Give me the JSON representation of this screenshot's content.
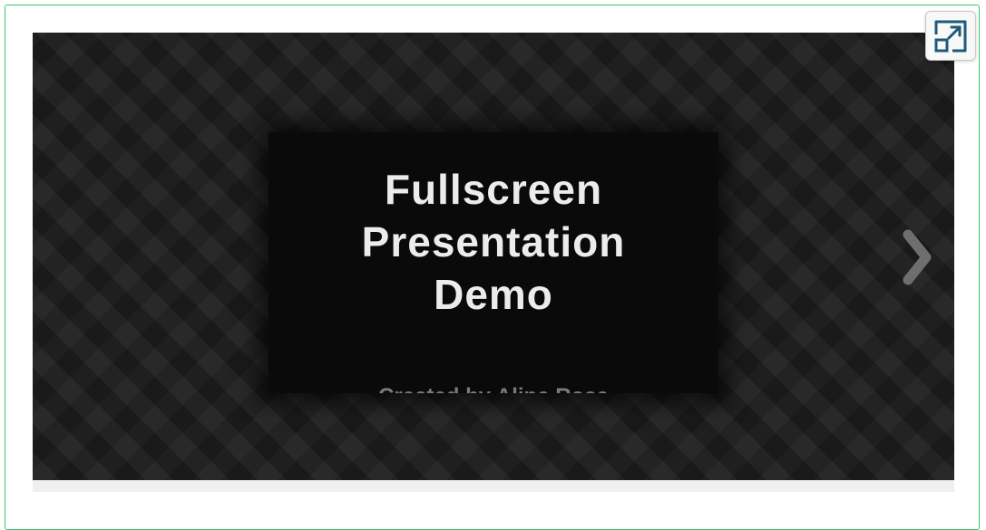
{
  "slide": {
    "title_lines": [
      "Fullscreen",
      "Presentation",
      "Demo"
    ],
    "author_text": "Created by Aline Rosa"
  },
  "controls": {
    "next_icon": "chevron-right-icon",
    "fullscreen_icon": "expand-arrow-icon"
  },
  "colors": {
    "frame_border": "#3cc46a",
    "viewer_background": "#1c1c1c",
    "slide_background": "#0a0a0a",
    "title_text": "#ececec",
    "arrow": "#6e6e6e",
    "fullscreen_icon": "#1f5a7a"
  }
}
